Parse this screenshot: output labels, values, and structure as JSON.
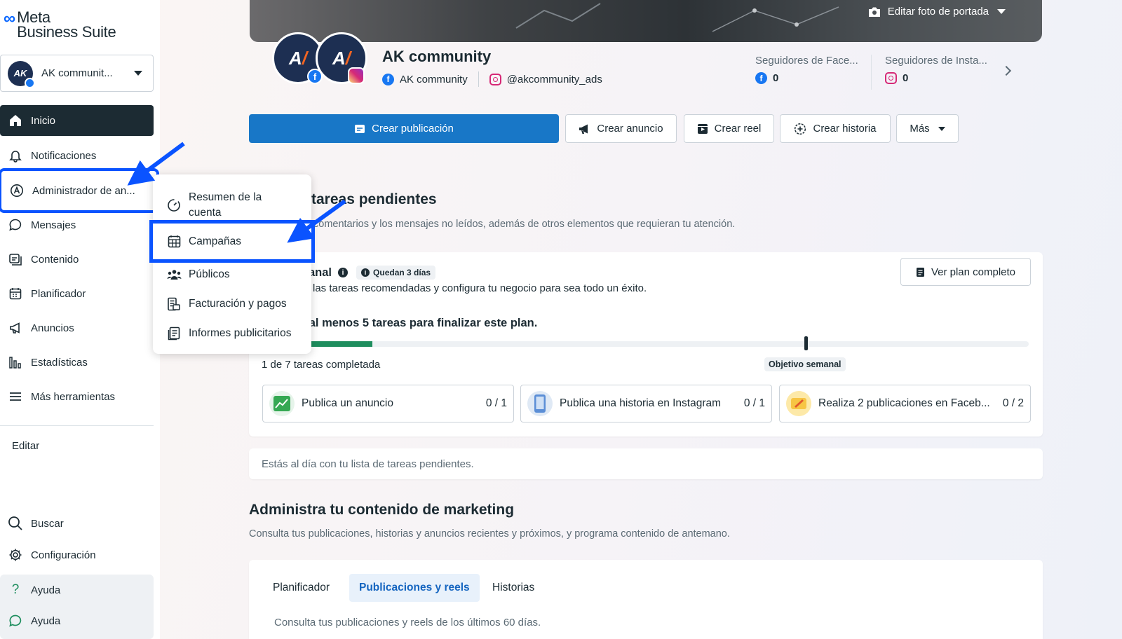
{
  "brand": {
    "logo_line1": "Meta",
    "logo_line2": "Business Suite"
  },
  "account": {
    "name": "AK communit...",
    "avatar_text": "AK"
  },
  "sidebar": {
    "items": [
      {
        "label": "Inicio",
        "icon": "home-icon"
      },
      {
        "label": "Notificaciones",
        "icon": "bell-icon"
      },
      {
        "label": "Administrador de an...",
        "icon": "ads-manager-icon"
      },
      {
        "label": "Mensajes",
        "icon": "chat-bubble-icon"
      },
      {
        "label": "Contenido",
        "icon": "content-icon"
      },
      {
        "label": "Planificador",
        "icon": "calendar-icon"
      },
      {
        "label": "Anuncios",
        "icon": "megaphone-icon"
      },
      {
        "label": "Estadísticas",
        "icon": "bar-chart-icon"
      },
      {
        "label": "Más herramientas",
        "icon": "menu-icon"
      }
    ],
    "edit_label": "Editar",
    "bottom": [
      {
        "label": "Buscar",
        "icon": "search-icon"
      },
      {
        "label": "Configuración",
        "icon": "gear-icon"
      },
      {
        "label": "Ayuda",
        "icon": "question-icon"
      },
      {
        "label": "Ayuda",
        "icon": "feedback-icon"
      }
    ]
  },
  "dropdown": {
    "items": [
      {
        "label": "Resumen de la cuenta",
        "icon": "gauge-icon"
      },
      {
        "label": "Campañas",
        "icon": "calendar-grid-icon"
      },
      {
        "label": "Públicos",
        "icon": "people-icon"
      },
      {
        "label": "Facturación y pagos",
        "icon": "billing-icon"
      },
      {
        "label": "Informes publicitarios",
        "icon": "report-icon"
      }
    ]
  },
  "header": {
    "cover_edit_label": "Editar foto de portada",
    "page_name": "AK community",
    "facebook_name": "AK community",
    "instagram_handle": "@akcommunity_ads",
    "fb_followers_label": "Seguidores de Face...",
    "fb_followers_value": "0",
    "ig_followers_label": "Seguidores de Insta...",
    "ig_followers_value": "0"
  },
  "actions": {
    "create_post": "Crear publicación",
    "create_ad": "Crear anuncio",
    "create_reel": "Crear reel",
    "create_story": "Crear historia",
    "more": "Más"
  },
  "tasks": {
    "title": "tareas pendientes",
    "description": "comentarios y los mensajes no leídos, además de otros elementos que requieran tu atención.",
    "plan_title": "anal",
    "plan_chip": "Quedan 3 días",
    "plan_description": "las tareas recomendadas y configura tu negocio para sea todo un éxito.",
    "plan_goal": "a al menos 5 tareas para finalizar este plan.",
    "view_plan_button": "Ver plan completo",
    "progress_fraction": 0.143,
    "goal_label": "Objetivo semanal",
    "completed_text": "1 de 7 tareas completada",
    "items": [
      {
        "label": "Publica un anuncio",
        "count": "0 / 1"
      },
      {
        "label": "Publica una historia en Instagram",
        "count": "0 / 1"
      },
      {
        "label": "Realiza 2 publicaciones en Faceb...",
        "count": "0 / 2"
      }
    ],
    "up_to_date": "Estás al día con tu lista de tareas pendientes."
  },
  "marketing": {
    "title": "Administra tu contenido de marketing",
    "description": "Consulta tus publicaciones, historias y anuncios recientes y próximos, y programa contenido de antemano.",
    "tabs": [
      "Planificador",
      "Publicaciones y reels",
      "Historias"
    ],
    "active_tab": "Publicaciones y reels",
    "tab_description": "Consulta tus publicaciones y reels de los últimos 60 días."
  },
  "colors": {
    "accent": "#1877c7",
    "highlight_box": "#0a53ff",
    "progress": "#1e8e5e",
    "sidebar_active": "#1c2b33"
  }
}
